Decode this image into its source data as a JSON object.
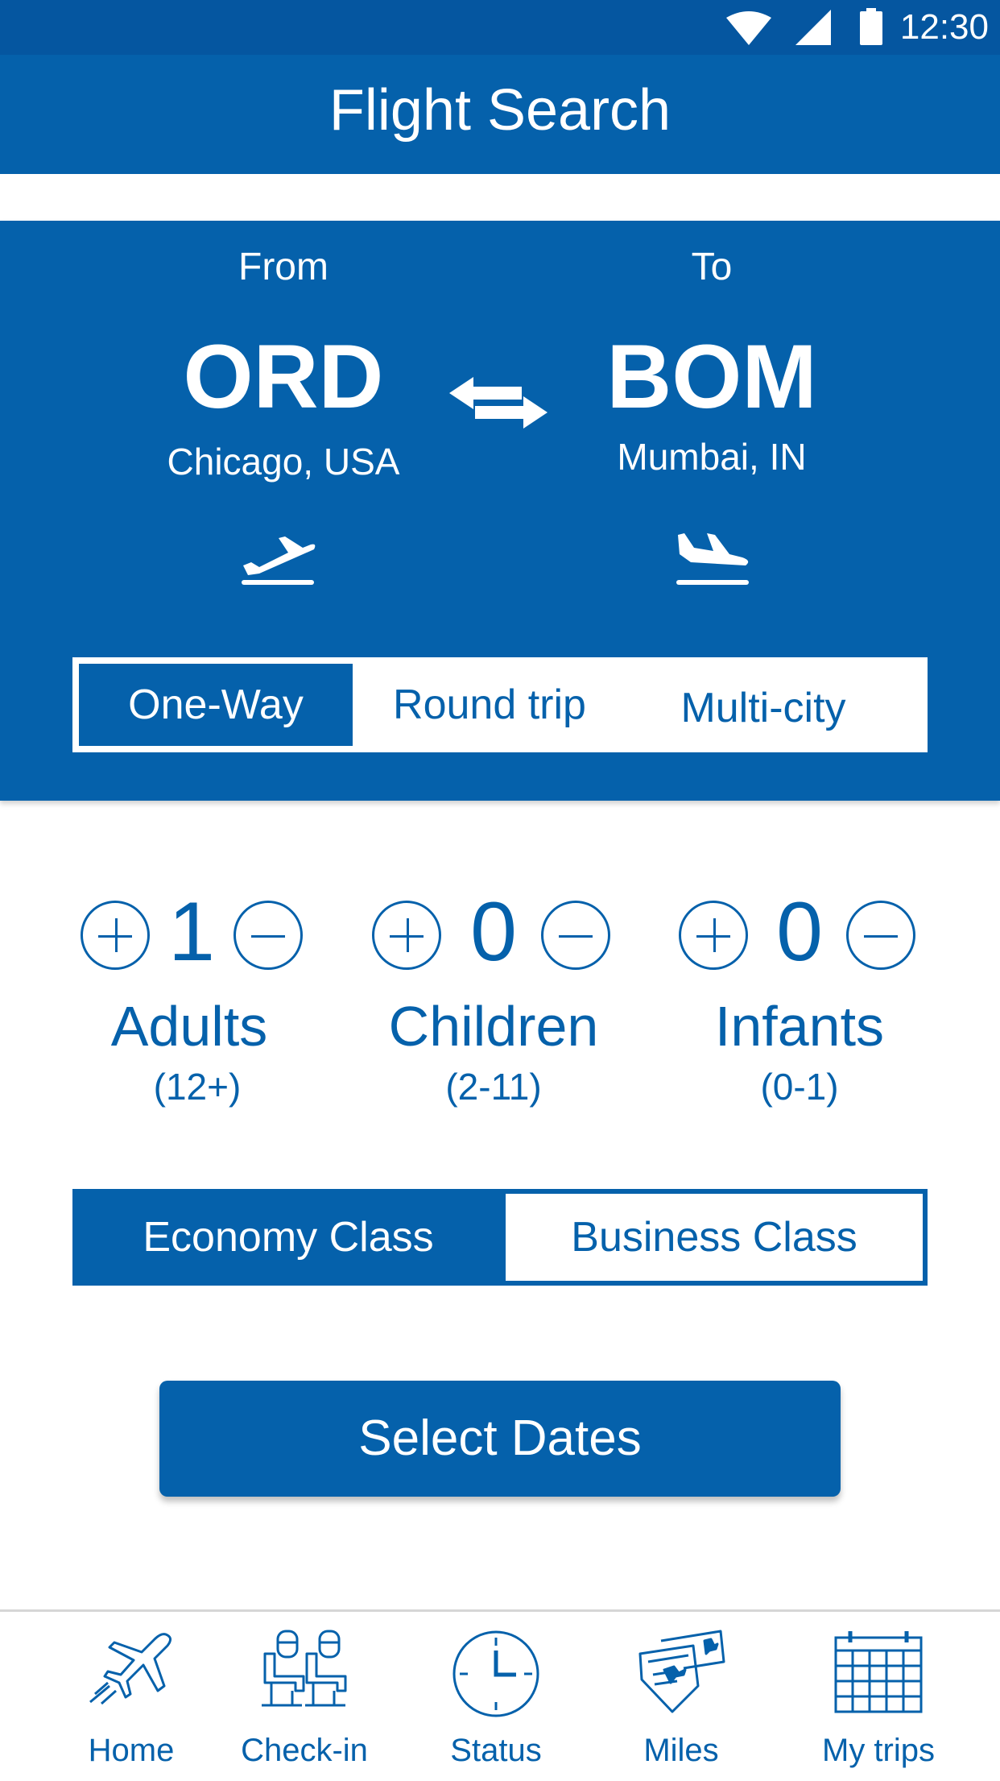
{
  "status_bar": {
    "time": "12:30"
  },
  "header": {
    "title": "Flight Search"
  },
  "route": {
    "from": {
      "label": "From",
      "code": "ORD",
      "city": "Chicago, USA"
    },
    "to": {
      "label": "To",
      "code": "BOM",
      "city": "Mumbai, IN"
    }
  },
  "trip_types": [
    {
      "label": "One-Way",
      "selected": true
    },
    {
      "label": "Round trip",
      "selected": false
    },
    {
      "label": "Multi-city",
      "selected": false
    }
  ],
  "passengers": [
    {
      "count": "1",
      "label": "Adults",
      "range": "(12+)"
    },
    {
      "count": "0",
      "label": "Children",
      "range": "(2-11)"
    },
    {
      "count": "0",
      "label": "Infants",
      "range": "(0-1)"
    }
  ],
  "cabin_class": {
    "economy": "Economy Class",
    "business": "Business Class",
    "selected": "Economy Class"
  },
  "actions": {
    "select_dates": "Select Dates"
  },
  "nav": [
    {
      "label": "Home",
      "icon": "airplane-icon"
    },
    {
      "label": "Check-in",
      "icon": "seats-icon"
    },
    {
      "label": "Status",
      "icon": "clock-icon"
    },
    {
      "label": "Miles",
      "icon": "tickets-icon"
    },
    {
      "label": "My trips",
      "icon": "calendar-icon"
    }
  ],
  "colors": {
    "primary": "#0561ab",
    "status_bar": "#0556a0",
    "background": "#ffffff"
  }
}
